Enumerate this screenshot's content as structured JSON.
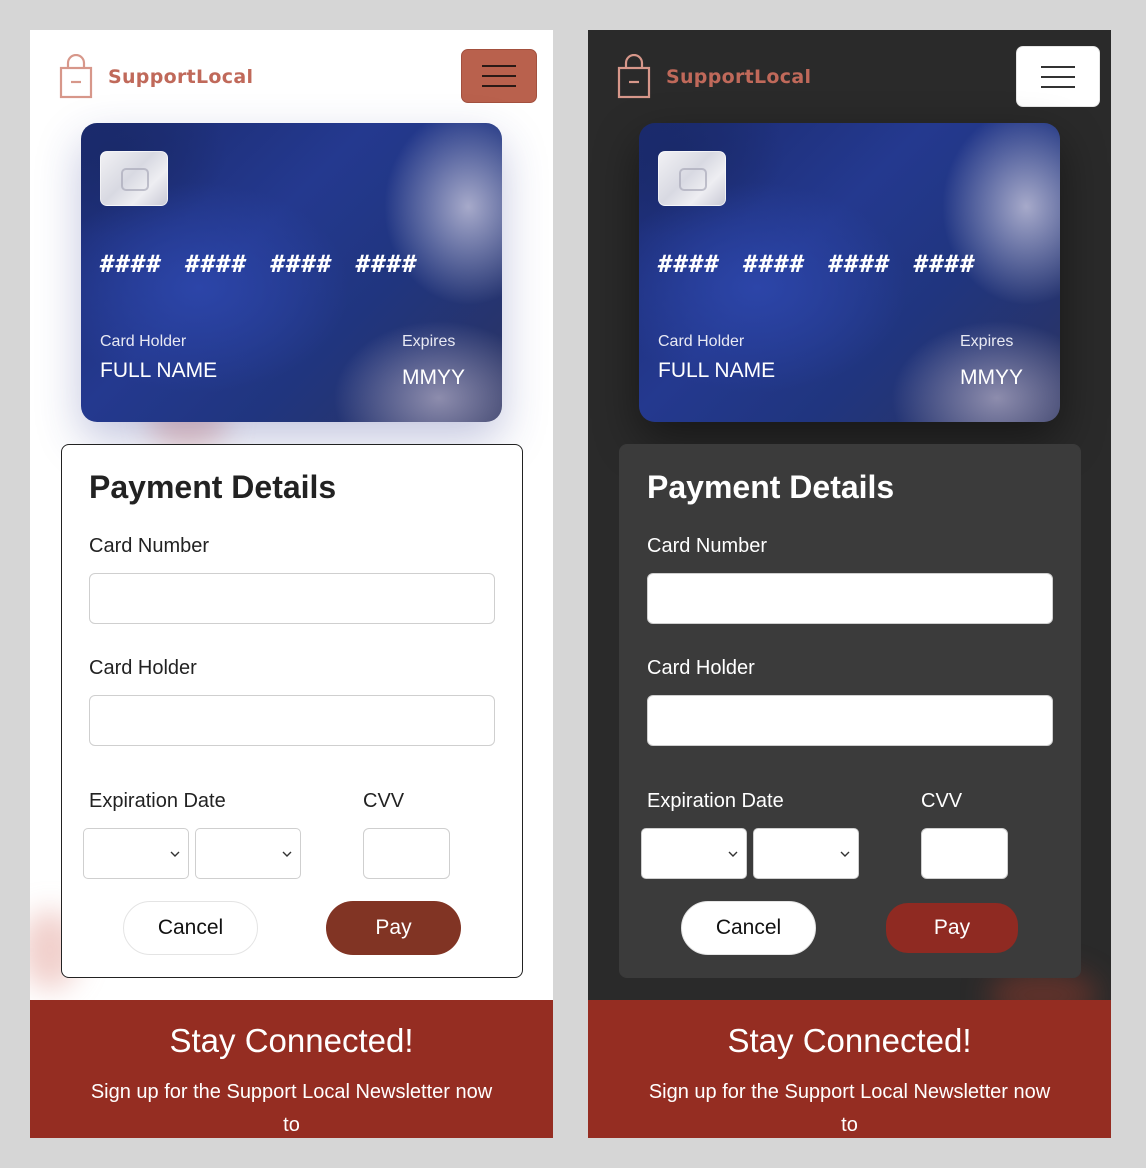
{
  "brand": {
    "name": "SupportLocal",
    "color": "#c0695a"
  },
  "themes": [
    "light",
    "dark"
  ],
  "card_preview": {
    "number_placeholder": "#### #### #### ####",
    "holder_label": "Card Holder",
    "holder_value": "FULL NAME",
    "expires_label": "Expires",
    "expires_value": "MMYY"
  },
  "form": {
    "title": "Payment Details",
    "card_number_label": "Card Number",
    "card_number_value": "",
    "card_holder_label": "Card Holder",
    "card_holder_value": "",
    "expiration_label": "Expiration Date",
    "month_selected": "",
    "year_selected": "",
    "cvv_label": "CVV",
    "cvv_value": "",
    "cancel_label": "Cancel",
    "pay_label": "Pay"
  },
  "footer": {
    "title": "Stay Connected!",
    "text": "Sign up for the Support Local Newsletter now to"
  },
  "colors": {
    "accent": "#b9614d",
    "pay_light": "#813424",
    "pay_dark": "#8f2a22",
    "footer": "#952d22",
    "dark_bg": "#2a2a2a",
    "dark_panel": "#3b3b3b"
  },
  "icons": [
    "shopping-bag-icon",
    "menu-icon",
    "chevron-down-icon",
    "card-chip-icon"
  ]
}
